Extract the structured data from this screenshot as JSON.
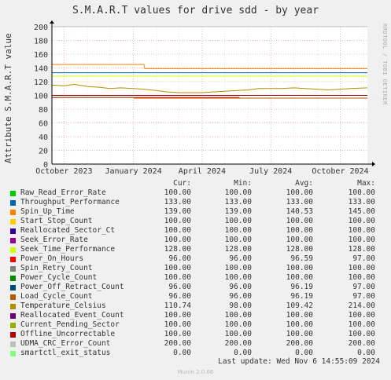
{
  "title": "S.M.A.R.T values for drive sdd - by year",
  "side_label": "RRDTOOL / TOBI OETIKER",
  "ylabel": "Attribute S.M.A.R.T value",
  "legend_headers": {
    "cur": "Cur:",
    "min": "Min:",
    "avg": "Avg:",
    "max": "Max:"
  },
  "legend": [
    {
      "name": "Raw_Read_Error_Rate",
      "color": "#00cc00",
      "cur": "100.00",
      "min": "100.00",
      "avg": "100.00",
      "max": "100.00"
    },
    {
      "name": "Throughput_Performance",
      "color": "#0066b3",
      "cur": "133.00",
      "min": "133.00",
      "avg": "133.00",
      "max": "133.00"
    },
    {
      "name": "Spin_Up_Time",
      "color": "#ff8000",
      "cur": "139.00",
      "min": "139.00",
      "avg": "140.53",
      "max": "145.00"
    },
    {
      "name": "Start_Stop_Count",
      "color": "#ffcc00",
      "cur": "100.00",
      "min": "100.00",
      "avg": "100.00",
      "max": "100.00"
    },
    {
      "name": "Reallocated_Sector_Ct",
      "color": "#330099",
      "cur": "100.00",
      "min": "100.00",
      "avg": "100.00",
      "max": "100.00"
    },
    {
      "name": "Seek_Error_Rate",
      "color": "#990099",
      "cur": "100.00",
      "min": "100.00",
      "avg": "100.00",
      "max": "100.00"
    },
    {
      "name": "Seek_Time_Performance",
      "color": "#ccff00",
      "cur": "128.00",
      "min": "128.00",
      "avg": "128.00",
      "max": "128.00"
    },
    {
      "name": "Power_On_Hours",
      "color": "#ff0000",
      "cur": "96.00",
      "min": "96.00",
      "avg": "96.59",
      "max": "97.00"
    },
    {
      "name": "Spin_Retry_Count",
      "color": "#808080",
      "cur": "100.00",
      "min": "100.00",
      "avg": "100.00",
      "max": "100.00"
    },
    {
      "name": "Power_Cycle_Count",
      "color": "#008f00",
      "cur": "100.00",
      "min": "100.00",
      "avg": "100.00",
      "max": "100.00"
    },
    {
      "name": "Power_Off_Retract_Count",
      "color": "#00487d",
      "cur": "96.00",
      "min": "96.00",
      "avg": "96.19",
      "max": "97.00"
    },
    {
      "name": "Load_Cycle_Count",
      "color": "#b35a00",
      "cur": "96.00",
      "min": "96.00",
      "avg": "96.19",
      "max": "97.00"
    },
    {
      "name": "Temperature_Celsius",
      "color": "#b38f00",
      "cur": "110.74",
      "min": "98.00",
      "avg": "109.42",
      "max": "214.00"
    },
    {
      "name": "Reallocated_Event_Count",
      "color": "#6b006b",
      "cur": "100.00",
      "min": "100.00",
      "avg": "100.00",
      "max": "100.00"
    },
    {
      "name": "Current_Pending_Sector",
      "color": "#8fb300",
      "cur": "100.00",
      "min": "100.00",
      "avg": "100.00",
      "max": "100.00"
    },
    {
      "name": "Offline_Uncorrectable",
      "color": "#b30000",
      "cur": "100.00",
      "min": "100.00",
      "avg": "100.00",
      "max": "100.00"
    },
    {
      "name": "UDMA_CRC_Error_Count",
      "color": "#bebebe",
      "cur": "200.00",
      "min": "200.00",
      "avg": "200.00",
      "max": "200.00"
    },
    {
      "name": "smartctl_exit_status",
      "color": "#80ff80",
      "cur": "0.00",
      "min": "0.00",
      "avg": "0.00",
      "max": "0.00"
    }
  ],
  "last_update": "Last update: Wed Nov  6 14:55:09 2024",
  "munin_version": "Munin 2.0.66",
  "chart_data": {
    "type": "line",
    "title": "S.M.A.R.T values for drive sdd - by year",
    "ylabel": "Attribute S.M.A.R.T value",
    "xlabel": "",
    "x_range": [
      "2023-09-15",
      "2024-11-06"
    ],
    "xticks": [
      {
        "label": "October 2023",
        "date": "2023-10-01"
      },
      {
        "label": "January 2024",
        "date": "2024-01-01"
      },
      {
        "label": "April 2024",
        "date": "2024-04-01"
      },
      {
        "label": "July 2024",
        "date": "2024-07-01"
      },
      {
        "label": "October 2024",
        "date": "2024-10-01"
      }
    ],
    "ylim": [
      0,
      200
    ],
    "yticks": [
      0,
      20,
      40,
      60,
      80,
      100,
      120,
      140,
      160,
      180,
      200
    ],
    "grid": true,
    "series": [
      {
        "name": "Throughput_Performance",
        "color": "#0066b3",
        "points": [
          [
            "2023-09-15",
            133
          ],
          [
            "2024-11-06",
            133
          ]
        ]
      },
      {
        "name": "Seek_Time_Performance",
        "color": "#ccff00",
        "points": [
          [
            "2023-09-15",
            128
          ],
          [
            "2024-11-06",
            128
          ]
        ]
      },
      {
        "name": "Spin_Up_Time",
        "color": "#ff8000",
        "points": [
          [
            "2023-09-15",
            145
          ],
          [
            "2024-01-15",
            145
          ],
          [
            "2024-01-16",
            139
          ],
          [
            "2024-11-06",
            139
          ]
        ]
      },
      {
        "name": "Power_On_Hours",
        "color": "#ff0000",
        "points": [
          [
            "2023-09-15",
            97
          ],
          [
            "2024-05-20",
            97
          ],
          [
            "2024-05-21",
            96
          ],
          [
            "2024-11-06",
            96
          ]
        ]
      },
      {
        "name": "Power_Off_Retract_Count",
        "color": "#00487d",
        "points": [
          [
            "2023-09-15",
            97
          ],
          [
            "2024-01-01",
            97
          ],
          [
            "2024-01-02",
            96
          ],
          [
            "2024-11-06",
            96
          ]
        ]
      },
      {
        "name": "Load_Cycle_Count",
        "color": "#b35a00",
        "points": [
          [
            "2023-09-15",
            97
          ],
          [
            "2024-01-01",
            97
          ],
          [
            "2024-01-02",
            96
          ],
          [
            "2024-11-06",
            96
          ]
        ]
      },
      {
        "name": "Raw_Read_Error_Rate",
        "color": "#00cc00",
        "points": [
          [
            "2023-09-15",
            100
          ],
          [
            "2024-11-06",
            100
          ]
        ]
      },
      {
        "name": "Start_Stop_Count",
        "color": "#ffcc00",
        "points": [
          [
            "2023-09-15",
            100
          ],
          [
            "2024-11-06",
            100
          ]
        ]
      },
      {
        "name": "Reallocated_Sector_Ct",
        "color": "#330099",
        "points": [
          [
            "2023-09-15",
            100
          ],
          [
            "2024-11-06",
            100
          ]
        ]
      },
      {
        "name": "Seek_Error_Rate",
        "color": "#990099",
        "points": [
          [
            "2023-09-15",
            100
          ],
          [
            "2024-11-06",
            100
          ]
        ]
      },
      {
        "name": "Spin_Retry_Count",
        "color": "#808080",
        "points": [
          [
            "2023-09-15",
            100
          ],
          [
            "2024-11-06",
            100
          ]
        ]
      },
      {
        "name": "Power_Cycle_Count",
        "color": "#008f00",
        "points": [
          [
            "2023-09-15",
            100
          ],
          [
            "2024-11-06",
            100
          ]
        ]
      },
      {
        "name": "Reallocated_Event_Count",
        "color": "#6b006b",
        "points": [
          [
            "2023-09-15",
            100
          ],
          [
            "2024-11-06",
            100
          ]
        ]
      },
      {
        "name": "Current_Pending_Sector",
        "color": "#8fb300",
        "points": [
          [
            "2023-09-15",
            100
          ],
          [
            "2024-11-06",
            100
          ]
        ]
      },
      {
        "name": "Offline_Uncorrectable",
        "color": "#b30000",
        "points": [
          [
            "2023-09-15",
            100
          ],
          [
            "2024-11-06",
            100
          ]
        ]
      },
      {
        "name": "Temperature_Celsius",
        "color": "#b38f00",
        "points": [
          [
            "2023-09-15",
            115
          ],
          [
            "2023-10-01",
            114
          ],
          [
            "2023-10-15",
            116
          ],
          [
            "2023-11-01",
            113
          ],
          [
            "2023-11-15",
            112
          ],
          [
            "2023-12-01",
            110
          ],
          [
            "2023-12-15",
            111
          ],
          [
            "2024-01-01",
            110
          ],
          [
            "2024-01-15",
            109
          ],
          [
            "2024-02-01",
            107
          ],
          [
            "2024-02-15",
            105
          ],
          [
            "2024-03-01",
            104
          ],
          [
            "2024-03-15",
            104
          ],
          [
            "2024-04-01",
            104
          ],
          [
            "2024-04-15",
            105
          ],
          [
            "2024-05-01",
            106
          ],
          [
            "2024-05-15",
            107
          ],
          [
            "2024-06-01",
            108
          ],
          [
            "2024-06-15",
            110
          ],
          [
            "2024-07-01",
            110
          ],
          [
            "2024-07-15",
            110
          ],
          [
            "2024-08-01",
            111
          ],
          [
            "2024-08-15",
            110
          ],
          [
            "2024-09-01",
            109
          ],
          [
            "2024-09-15",
            108
          ],
          [
            "2024-10-01",
            109
          ],
          [
            "2024-10-15",
            110
          ],
          [
            "2024-11-06",
            111
          ]
        ]
      },
      {
        "name": "UDMA_CRC_Error_Count",
        "color": "#bebebe",
        "points": [
          [
            "2023-09-15",
            200
          ],
          [
            "2024-11-06",
            200
          ]
        ]
      },
      {
        "name": "smartctl_exit_status",
        "color": "#80ff80",
        "points": [
          [
            "2023-09-15",
            0
          ],
          [
            "2024-11-06",
            0
          ]
        ]
      }
    ]
  }
}
